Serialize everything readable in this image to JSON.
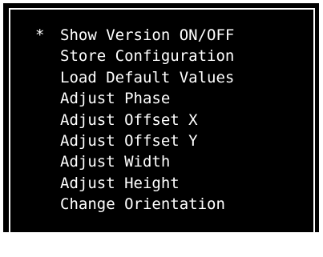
{
  "menu": {
    "cursor_symbol": "*",
    "items": [
      {
        "label": "Show Version ON/OFF",
        "selected": true
      },
      {
        "label": "Store Configuration",
        "selected": false
      },
      {
        "label": "Load Default Values",
        "selected": false
      },
      {
        "label": "Adjust Phase",
        "selected": false
      },
      {
        "label": "Adjust Offset X",
        "selected": false
      },
      {
        "label": "Adjust Offset Y",
        "selected": false
      },
      {
        "label": "Adjust Width",
        "selected": false
      },
      {
        "label": "Adjust Height",
        "selected": false
      },
      {
        "label": "Change Orientation",
        "selected": false
      }
    ]
  },
  "colors": {
    "background": "#000000",
    "text": "#ffffff",
    "frame": "#ffffff"
  }
}
